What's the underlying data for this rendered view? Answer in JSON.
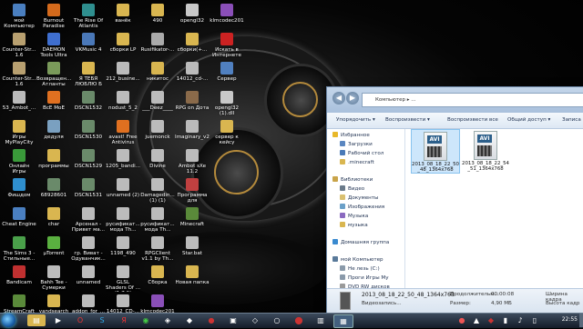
{
  "desktop": {
    "icons": [
      {
        "label": "мой Компьютер",
        "color": "#4a7fc0"
      },
      {
        "label": "Burnout Paradise",
        "color": "#d46a1c"
      },
      {
        "label": "The Rise Of Atlantis",
        "color": "#2f8f8f"
      },
      {
        "label": "ванёк",
        "color": "#d9b650"
      },
      {
        "label": "490",
        "color": "#d9b650"
      },
      {
        "label": "opengl32",
        "color": "#c8c8c8"
      },
      {
        "label": "klmcodec201",
        "color": "#8a4fb8"
      },
      {
        "label": "Counter-Str... 1.6",
        "color": "#b8a070"
      },
      {
        "label": "DAEMON Tools Ultra",
        "color": "#3f6fd0"
      },
      {
        "label": "VKMusic 4",
        "color": "#4a78b8"
      },
      {
        "label": "сборки LP",
        "color": "#d9b650"
      },
      {
        "label": "Rusifikator-...",
        "color": "#aaaaaa"
      },
      {
        "label": "сборки(+...",
        "color": "#d9b650"
      },
      {
        "label": "Искать в Интернете",
        "color": "#cc2222"
      },
      {
        "label": "Counter-Str... 1.6",
        "color": "#b8a070"
      },
      {
        "label": "Возвращен... Атланты",
        "color": "#7a9a5a"
      },
      {
        "label": "Я ТЕБЯ ЛЮБЛЮ Б",
        "color": "#d9b650"
      },
      {
        "label": "212_busine...",
        "color": "#bbbbbb"
      },
      {
        "label": "никитос",
        "color": "#d9b650"
      },
      {
        "label": "14012_cd-...",
        "color": "#bbbbbb"
      },
      {
        "label": "Сервер",
        "color": "#5080c0"
      },
      {
        "label": "53_Ambot_...",
        "color": "#bbbbbb"
      },
      {
        "label": "ВсЕ МоЕ",
        "color": "#e07020"
      },
      {
        "label": "DSCN1532",
        "color": "#6a8a6a"
      },
      {
        "label": "nodust_5_2",
        "color": "#bbbbbb"
      },
      {
        "label": "___Deez____",
        "color": "#bbbbbb"
      },
      {
        "label": "RPG on Дота",
        "color": "#8a6a4a"
      },
      {
        "label": "opengl32 (1).dll",
        "color": "#c8c8c8"
      },
      {
        "label": "Игры MyPlayCity",
        "color": "#d9b650"
      },
      {
        "label": "дедуля",
        "color": "#7aa0c0"
      },
      {
        "label": "DSCN1530",
        "color": "#6a8a6a"
      },
      {
        "label": "avast! Free Antivirus",
        "color": "#e07020"
      },
      {
        "label": "juemonck",
        "color": "#bbbbbb"
      },
      {
        "label": "Imaginary_v2",
        "color": "#bbbbbb"
      },
      {
        "label": "сервер к кейсу",
        "color": "#d9b650"
      },
      {
        "label": "Онлайн Игры",
        "color": "#3a9a3a"
      },
      {
        "label": "программы",
        "color": "#d9b650"
      },
      {
        "label": "DSCN1529",
        "color": "#6a8a6a"
      },
      {
        "label": "1205_bandi...",
        "color": "#bbbbbb"
      },
      {
        "label": "Divine",
        "color": "#bbbbbb"
      },
      {
        "label": "Ambot sXe 11.2",
        "color": "#bbbbbb"
      },
      {
        "label": "",
        "color": "transparent"
      },
      {
        "label": "Фишдом",
        "color": "#2f8fcf"
      },
      {
        "label": "68928601",
        "color": "#6a8a6a"
      },
      {
        "label": "DSCN1531",
        "color": "#6a8a6a"
      },
      {
        "label": "unnamed (2)",
        "color": "#bbbbbb"
      },
      {
        "label": "Damagedin... (1) (1)",
        "color": "#bbbbbb"
      },
      {
        "label": "Программа для записи...",
        "color": "#c04040"
      },
      {
        "label": "",
        "color": "transparent"
      },
      {
        "label": "Cheat Engine",
        "color": "#4a7fc0"
      },
      {
        "label": "char",
        "color": "#d9b650"
      },
      {
        "label": "Арсенал - Привет ма...",
        "color": "#bbbbbb"
      },
      {
        "label": "русификат... мода Th...",
        "color": "#bbbbbb"
      },
      {
        "label": "русификат... мода Th...",
        "color": "#bbbbbb"
      },
      {
        "label": "Minecraft",
        "color": "#5a8a3a"
      },
      {
        "label": "",
        "color": "transparent"
      },
      {
        "label": "The Sims 3 - Стильные...",
        "color": "#4aa04a"
      },
      {
        "label": "µTorrent",
        "color": "#5ab040"
      },
      {
        "label": "гр. Виват - Одуванчик...",
        "color": "#bbbbbb"
      },
      {
        "label": "1198_490",
        "color": "#bbbbbb"
      },
      {
        "label": "RPGClient v1.1 by Th...",
        "color": "#bbbbbb"
      },
      {
        "label": "Star.bat",
        "color": "#bbbbbb"
      },
      {
        "label": "",
        "color": "transparent"
      },
      {
        "label": "Bandicam",
        "color": "#c03030"
      },
      {
        "label": "Bahh Tee - Сумерки",
        "color": "#bbbbbb"
      },
      {
        "label": "unnamed",
        "color": "#bbbbbb"
      },
      {
        "label": "GLSL Shaders Of ...(1.7.2)",
        "color": "#bbbbbb"
      },
      {
        "label": "Сборка",
        "color": "#d9b650"
      },
      {
        "label": "Новая папка",
        "color": "#d9b650"
      },
      {
        "label": "",
        "color": "transparent"
      },
      {
        "label": "StreamCraft",
        "color": "#5a8a3a"
      },
      {
        "label": "yandsearch",
        "color": "#d9b650"
      },
      {
        "label": "addon_for_...",
        "color": "#bbbbbb"
      },
      {
        "label": "14012_CD-...",
        "color": "#bbbbbb"
      },
      {
        "label": "klmcodec201",
        "color": "#8a4fb8"
      },
      {
        "label": "",
        "color": "transparent"
      },
      {
        "label": "",
        "color": "transparent"
      }
    ]
  },
  "explorer": {
    "address": "Компьютер ▸ ...",
    "toolbar": {
      "organize": "Упорядочить ▾",
      "play": "Воспроизвести ▾",
      "play_all": "Воспроизвести все",
      "share": "Общий доступ ▾",
      "burn": "Записа"
    },
    "nav": {
      "favorites": "Избранное",
      "downloads": "Загрузки",
      "desktop": "Рабочий стол",
      "minecraft": ".minecraft",
      "libraries": "Библиотеки",
      "video": "Видео",
      "documents": "Документы",
      "images": "Изображения",
      "music": "Музыка",
      "music2": "музыка",
      "homegroup": "Домашняя группа",
      "computer": "мой Компьютер",
      "drive_c": "Не лезь (C:)",
      "drive_games": "Проги Игры My",
      "dvd": "DVD RW дисков"
    },
    "files": [
      {
        "name": "2013_08_18_22_50_48_1364x768",
        "type": "AVI"
      },
      {
        "name": "2013_08_18_22_54_51_1364x768",
        "type": "AVI"
      }
    ],
    "details": {
      "filename": "2013_08_18_22_50_48_1364x768",
      "duration_label": "Продолжительн...",
      "duration": "00:00:08",
      "size_label": "Размер:",
      "size": "4,90 МБ",
      "width_label": "Ширина кадра",
      "height_label": "Высота кадр",
      "filetype": "Видеозапись..."
    }
  },
  "taskbar": {
    "clock": "22:55"
  }
}
